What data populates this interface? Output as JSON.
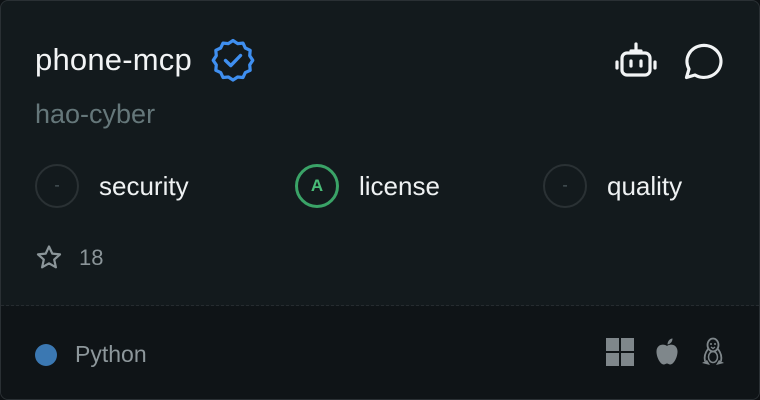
{
  "server": {
    "name": "phone-mcp",
    "author": "hao-cyber",
    "verified_icon": "verified-badge-icon"
  },
  "actions": [
    {
      "icon": "robot-icon"
    },
    {
      "icon": "chat-bubble-icon"
    }
  ],
  "scores": [
    {
      "grade": "-",
      "label": "security"
    },
    {
      "grade": "A",
      "label": "license"
    },
    {
      "grade": "-",
      "label": "quality"
    }
  ],
  "stars": {
    "icon": "star-icon",
    "count": "18"
  },
  "footer": {
    "language": "Python",
    "language_color": "#3b78b2",
    "platforms": [
      "windows-icon",
      "apple-icon",
      "linux-icon"
    ]
  },
  "colors": {
    "background": "#131a1d",
    "accent_blue": "#3f8ff0",
    "grade_a": "#3aa367"
  }
}
